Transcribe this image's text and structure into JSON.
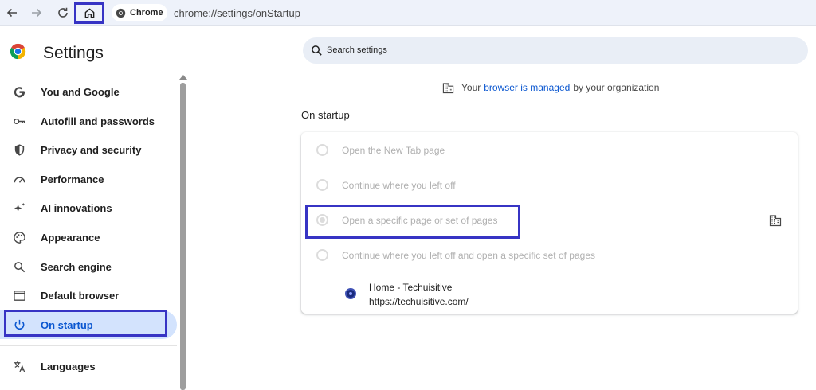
{
  "toolbar": {
    "chip_label": "Chrome",
    "url": "chrome://settings/onStartup"
  },
  "sidebar": {
    "title": "Settings",
    "items": [
      {
        "label": "You and Google",
        "icon": "google-icon"
      },
      {
        "label": "Autofill and passwords",
        "icon": "key-icon"
      },
      {
        "label": "Privacy and security",
        "icon": "shield-icon"
      },
      {
        "label": "Performance",
        "icon": "speedometer-icon"
      },
      {
        "label": "AI innovations",
        "icon": "sparkle-icon"
      },
      {
        "label": "Appearance",
        "icon": "palette-icon"
      },
      {
        "label": "Search engine",
        "icon": "search-icon"
      },
      {
        "label": "Default browser",
        "icon": "browser-window-icon"
      },
      {
        "label": "On startup",
        "icon": "power-icon",
        "active": true
      },
      {
        "label": "Languages",
        "icon": "translate-icon"
      }
    ]
  },
  "main": {
    "search_placeholder": "Search settings",
    "managed": {
      "prefix": "Your",
      "link": "browser is managed",
      "suffix": "by your organization"
    },
    "section_title": "On startup",
    "options": [
      {
        "label": "Open the New Tab page",
        "checked": false
      },
      {
        "label": "Continue where you left off",
        "checked": false
      },
      {
        "label": "Open a specific page or set of pages",
        "checked": true
      },
      {
        "label": "Continue where you left off and open a specific set of pages",
        "checked": false
      }
    ],
    "startup_page": {
      "title": "Home - Techuisitive",
      "url": "https://techuisitive.com/"
    }
  },
  "colors": {
    "accent": "#0b57d0",
    "active_bg": "#d3e3fd",
    "highlight_frame": "#3734c4",
    "toolbar_bg": "#eef2fa"
  }
}
